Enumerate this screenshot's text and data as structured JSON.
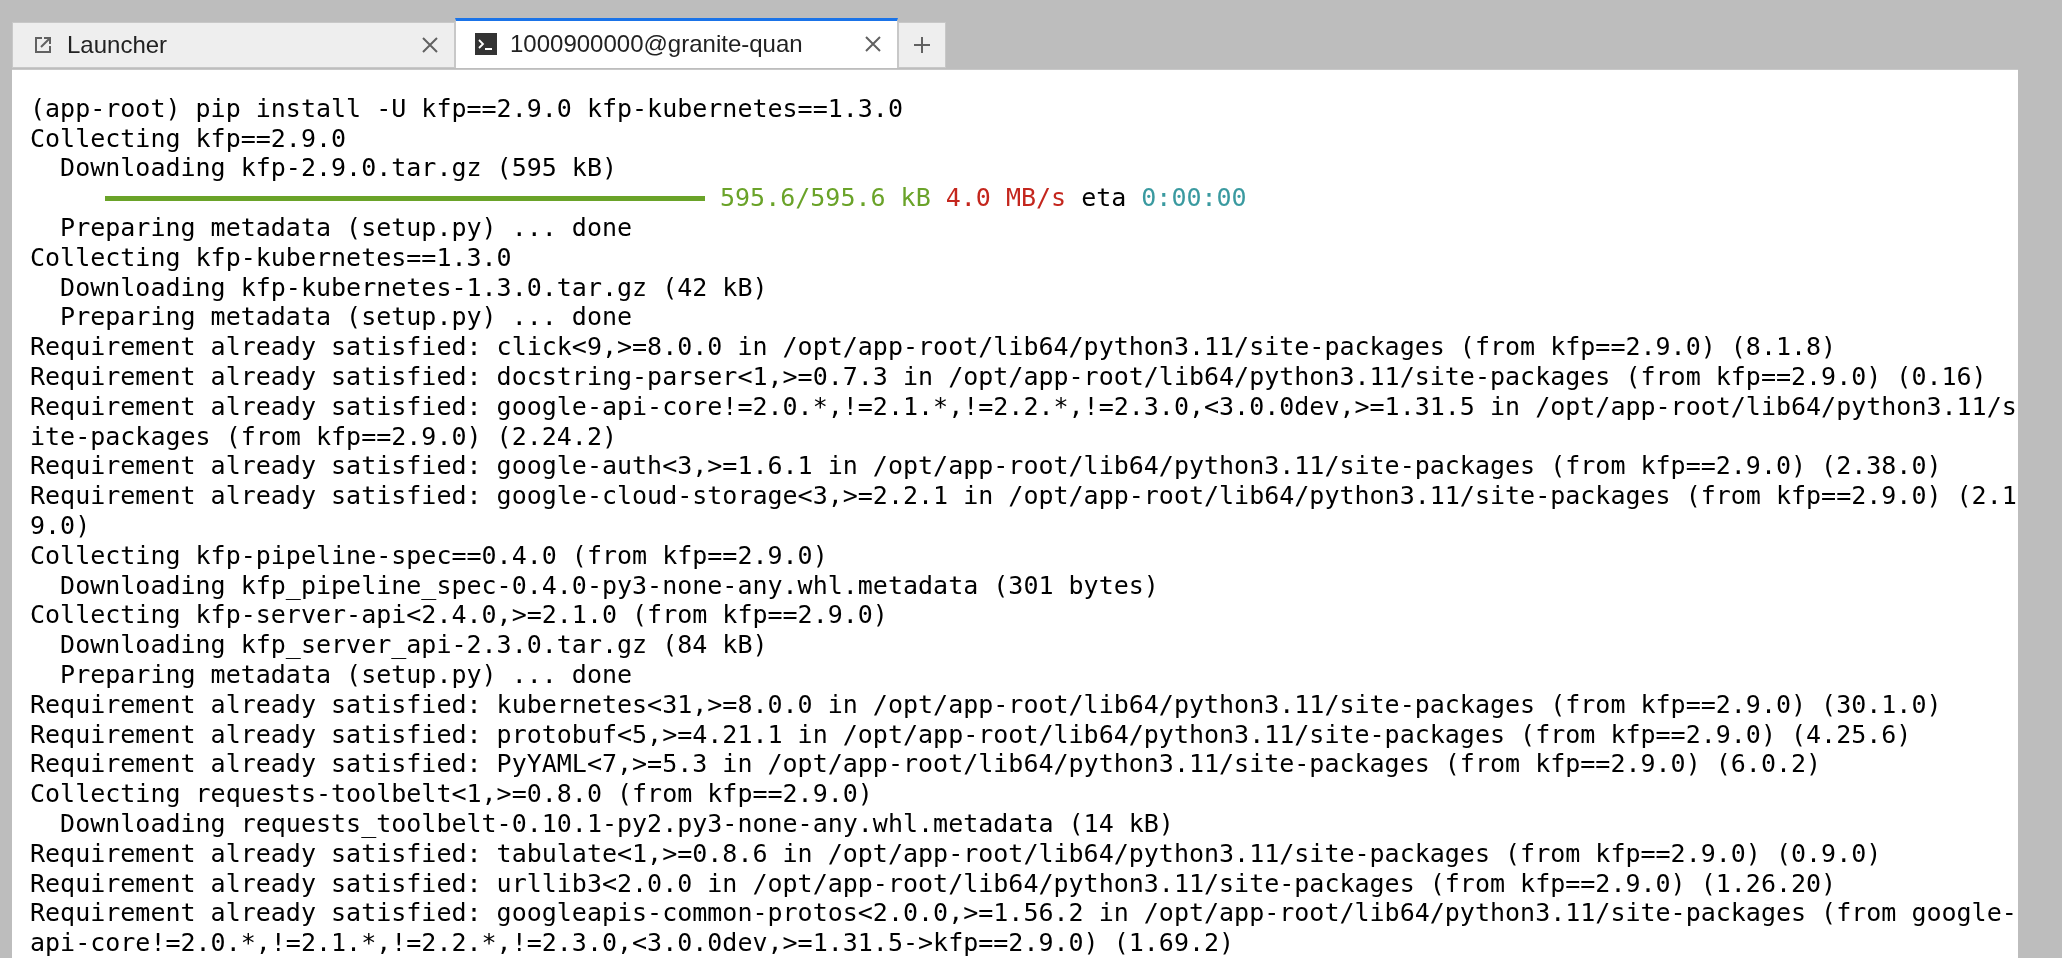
{
  "tabs": [
    {
      "kind": "launcher",
      "label": "Launcher",
      "selected": false
    },
    {
      "kind": "terminal",
      "label": "1000900000@granite-quan",
      "selected": true
    }
  ],
  "terminal": {
    "lines": [
      {
        "kind": "text",
        "text": "(app-root) pip install -U kfp==2.9.0 kfp-kubernetes==1.3.0"
      },
      {
        "kind": "text",
        "text": "Collecting kfp==2.9.0"
      },
      {
        "kind": "text",
        "text": "  Downloading kfp-2.9.0.tar.gz (595 kB)"
      },
      {
        "kind": "progress",
        "level": 1,
        "done": "595.6/595.6 kB",
        "speed": "4.0 MB/s",
        "eta_label": "eta",
        "eta": "0:00:00"
      },
      {
        "kind": "text",
        "text": "  Preparing metadata (setup.py) ... done"
      },
      {
        "kind": "text",
        "text": "Collecting kfp-kubernetes==1.3.0"
      },
      {
        "kind": "text",
        "text": "  Downloading kfp-kubernetes-1.3.0.tar.gz (42 kB)"
      },
      {
        "kind": "text",
        "text": "  Preparing metadata (setup.py) ... done"
      },
      {
        "kind": "text",
        "text": "Requirement already satisfied: click<9,>=8.0.0 in /opt/app-root/lib64/python3.11/site-packages (from kfp==2.9.0) (8.1.8)"
      },
      {
        "kind": "text",
        "text": "Requirement already satisfied: docstring-parser<1,>=0.7.3 in /opt/app-root/lib64/python3.11/site-packages (from kfp==2.9.0) (0.16)"
      },
      {
        "kind": "text",
        "text": "Requirement already satisfied: google-api-core!=2.0.*,!=2.1.*,!=2.2.*,!=2.3.0,<3.0.0dev,>=1.31.5 in /opt/app-root/lib64/python3.11/s"
      },
      {
        "kind": "text",
        "text": "ite-packages (from kfp==2.9.0) (2.24.2)"
      },
      {
        "kind": "text",
        "text": "Requirement already satisfied: google-auth<3,>=1.6.1 in /opt/app-root/lib64/python3.11/site-packages (from kfp==2.9.0) (2.38.0)"
      },
      {
        "kind": "text",
        "text": "Requirement already satisfied: google-cloud-storage<3,>=2.2.1 in /opt/app-root/lib64/python3.11/site-packages (from kfp==2.9.0) (2.1"
      },
      {
        "kind": "text",
        "text": "9.0)"
      },
      {
        "kind": "text",
        "text": "Collecting kfp-pipeline-spec==0.4.0 (from kfp==2.9.0)"
      },
      {
        "kind": "text",
        "text": "  Downloading kfp_pipeline_spec-0.4.0-py3-none-any.whl.metadata (301 bytes)"
      },
      {
        "kind": "text",
        "text": "Collecting kfp-server-api<2.4.0,>=2.1.0 (from kfp==2.9.0)"
      },
      {
        "kind": "text",
        "text": "  Downloading kfp_server_api-2.3.0.tar.gz (84 kB)"
      },
      {
        "kind": "text",
        "text": "  Preparing metadata (setup.py) ... done"
      },
      {
        "kind": "text",
        "text": "Requirement already satisfied: kubernetes<31,>=8.0.0 in /opt/app-root/lib64/python3.11/site-packages (from kfp==2.9.0) (30.1.0)"
      },
      {
        "kind": "text",
        "text": "Requirement already satisfied: protobuf<5,>=4.21.1 in /opt/app-root/lib64/python3.11/site-packages (from kfp==2.9.0) (4.25.6)"
      },
      {
        "kind": "text",
        "text": "Requirement already satisfied: PyYAML<7,>=5.3 in /opt/app-root/lib64/python3.11/site-packages (from kfp==2.9.0) (6.0.2)"
      },
      {
        "kind": "text",
        "text": "Collecting requests-toolbelt<1,>=0.8.0 (from kfp==2.9.0)"
      },
      {
        "kind": "text",
        "text": "  Downloading requests_toolbelt-0.10.1-py2.py3-none-any.whl.metadata (14 kB)"
      },
      {
        "kind": "text",
        "text": "Requirement already satisfied: tabulate<1,>=0.8.6 in /opt/app-root/lib64/python3.11/site-packages (from kfp==2.9.0) (0.9.0)"
      },
      {
        "kind": "text",
        "text": "Requirement already satisfied: urllib3<2.0.0 in /opt/app-root/lib64/python3.11/site-packages (from kfp==2.9.0) (1.26.20)"
      },
      {
        "kind": "text",
        "text": "Requirement already satisfied: googleapis-common-protos<2.0.0,>=1.56.2 in /opt/app-root/lib64/python3.11/site-packages (from google-"
      },
      {
        "kind": "text",
        "text": "api-core!=2.0.*,!=2.1.*,!=2.2.*,!=2.3.0,<3.0.0dev,>=1.31.5->kfp==2.9.0) (1.69.2)"
      }
    ]
  }
}
